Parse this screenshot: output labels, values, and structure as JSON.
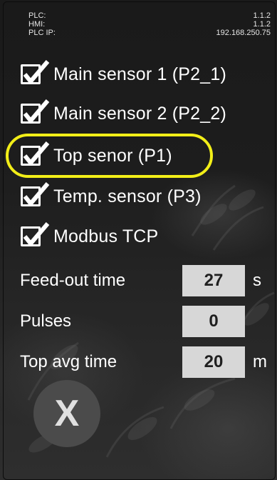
{
  "info": {
    "rows": [
      {
        "label": "PLC:",
        "value": "1.1.2"
      },
      {
        "label": "HMI:",
        "value": "1.1.2"
      },
      {
        "label": "PLC IP:",
        "value": "192.168.250.75"
      }
    ]
  },
  "sensors": [
    {
      "label": "Main sensor 1 (P2_1)",
      "checked": true
    },
    {
      "label": "Main sensor 2 (P2_2)",
      "checked": true
    },
    {
      "label": "Top senor (P1)",
      "checked": true
    },
    {
      "label": "Temp. sensor (P3)",
      "checked": true
    },
    {
      "label": "Modbus TCP",
      "checked": true
    }
  ],
  "params": [
    {
      "label": "Feed-out time",
      "value": "27",
      "unit": "s"
    },
    {
      "label": "Pulses",
      "value": "0",
      "unit": ""
    },
    {
      "label": "Top avg time",
      "value": "20",
      "unit": "m"
    }
  ],
  "close_button": {
    "label": "X"
  },
  "colors": {
    "highlight": "#f2ee18",
    "field_bg": "#d7d7d7",
    "button_bg": "#4b4b4b"
  }
}
